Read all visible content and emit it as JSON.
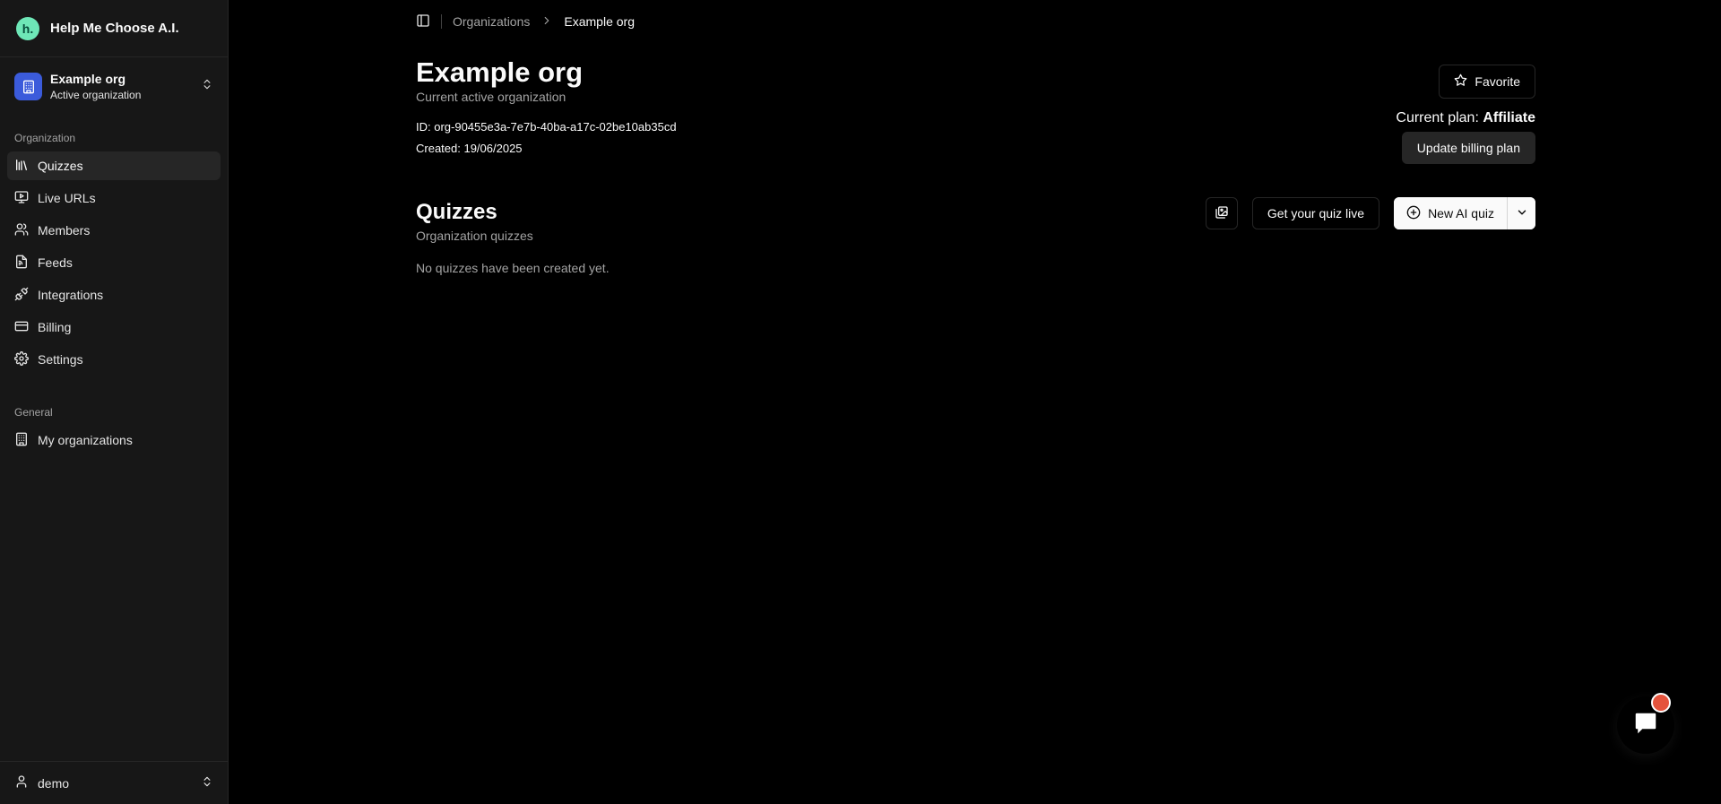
{
  "brand": {
    "logo_text": "h.",
    "name": "Help Me Choose A.I."
  },
  "org_switcher": {
    "name": "Example org",
    "subtitle": "Active organization"
  },
  "sidebar": {
    "section_org": "Organization",
    "items": [
      {
        "label": "Quizzes",
        "icon": "library-icon",
        "active": true
      },
      {
        "label": "Live URLs",
        "icon": "monitor-play-icon"
      },
      {
        "label": "Members",
        "icon": "users-icon"
      },
      {
        "label": "Feeds",
        "icon": "rss-file-icon"
      },
      {
        "label": "Integrations",
        "icon": "plug-icon"
      },
      {
        "label": "Billing",
        "icon": "credit-card-icon"
      },
      {
        "label": "Settings",
        "icon": "gear-icon"
      }
    ],
    "section_general": "General",
    "general_items": [
      {
        "label": "My organizations",
        "icon": "building-icon"
      }
    ],
    "user": "demo"
  },
  "breadcrumb": {
    "parent": "Organizations",
    "current": "Example org"
  },
  "org": {
    "title": "Example org",
    "subtitle": "Current active organization",
    "id_line": "ID: org-90455e3a-7e7b-40ba-a17c-02be10ab35cd",
    "created_line": "Created: 19/06/2025",
    "favorite_label": "Favorite",
    "plan_prefix": "Current plan: ",
    "plan_name": "Affiliate",
    "update_billing_label": "Update billing plan"
  },
  "quizzes": {
    "title": "Quizzes",
    "subtitle": "Organization quizzes",
    "get_live_label": "Get your quiz live",
    "new_ai_label": "New AI quiz",
    "empty_text": "No quizzes have been created yet."
  },
  "colors": {
    "background": "#000000",
    "sidebar": "#171717",
    "brand_logo": "#6ee7b7",
    "org_avatar": "#3b5bdb",
    "chat_badge": "#e5533c"
  }
}
